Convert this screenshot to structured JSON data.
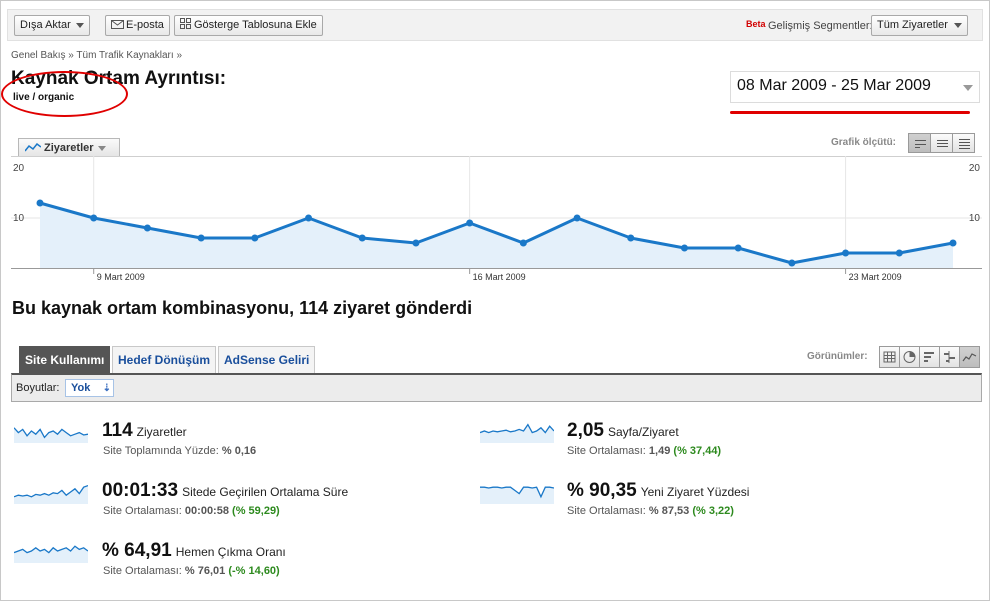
{
  "toolbar": {
    "export_label": "Dışa Aktar",
    "email_label": "E-posta",
    "dashboard_label": "Gösterge Tablosuna Ekle",
    "beta_label": "Beta",
    "segments_label": "Gelişmiş Segmentler:",
    "segment_value": "Tüm Ziyaretler"
  },
  "breadcrumb": "Genel Bakış » Tüm Trafik Kaynakları »",
  "page_title": "Kaynak Ortam Ayrıntısı:",
  "subtitle": "live / organic",
  "date_range": "08 Mar 2009 - 25 Mar 2009",
  "graph": {
    "metric_label": "Ziyaretler",
    "scale_label": "Grafik ölçütü:"
  },
  "chart_data": {
    "type": "area",
    "series": [
      {
        "name": "Ziyaretler",
        "values": [
          13,
          10,
          8,
          6,
          6,
          10,
          6,
          5,
          9,
          5,
          10,
          6,
          4,
          4,
          1,
          3,
          3,
          5
        ]
      }
    ],
    "ylim": [
      0,
      20
    ],
    "y_ticks": [
      "20",
      "10"
    ],
    "x_tick_labels": [
      "9 Mart 2009",
      "16 Mart 2009",
      "23 Mart 2009"
    ],
    "x_tick_index": [
      1,
      8,
      15
    ],
    "grid": true
  },
  "summary": "Bu kaynak ortam kombinasyonu, 114 ziyaret gönderdi",
  "tabs": [
    {
      "label": "Site Kullanımı",
      "active": true
    },
    {
      "label": "Hedef Dönüşüm",
      "active": false
    },
    {
      "label": "AdSense Geliri",
      "active": false
    }
  ],
  "views_label": "Görünümler:",
  "dimensions": {
    "label": "Boyutlar:",
    "value": "Yok"
  },
  "stats": [
    {
      "value": "114",
      "label": "Ziyaretler",
      "sub_label": "Site Toplamında Yüzde:",
      "sub_value": "% 0,16",
      "sub_change": ""
    },
    {
      "value": "2,05",
      "label": "Sayfa/Ziyaret",
      "sub_label": "Site Ortalaması:",
      "sub_value": "1,49",
      "sub_change": "(% 37,44)"
    },
    {
      "value": "00:01:33",
      "label": "Sitede Geçirilen Ortalama Süre",
      "sub_label": "Site Ortalaması:",
      "sub_value": "00:00:58",
      "sub_change": "(% 59,29)"
    },
    {
      "value": "% 90,35",
      "label": "Yeni Ziyaret Yüzdesi",
      "sub_label": "Site Ortalaması:",
      "sub_value": "% 87,53",
      "sub_change": "(% 3,22)"
    },
    {
      "value": "% 64,91",
      "label": "Hemen Çıkma Oranı",
      "sub_label": "Site Ortalaması:",
      "sub_value": "% 76,01",
      "sub_change": "(-% 14,60)"
    }
  ],
  "colors": {
    "line": "#1a78c8",
    "area": "#e4f0fa",
    "annotation": "#e00000",
    "positive": "#2d8a1e"
  }
}
